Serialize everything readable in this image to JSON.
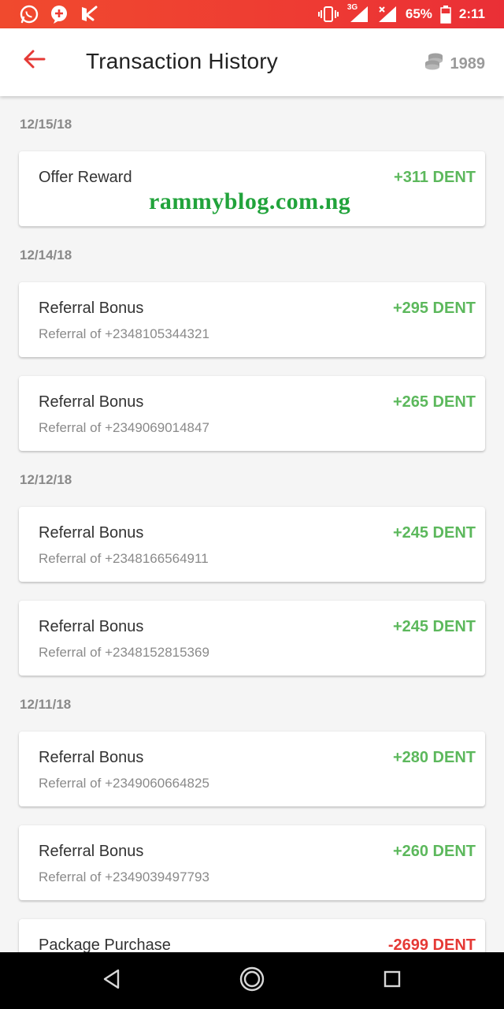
{
  "status_bar": {
    "signal_label": "3G",
    "battery": "65%",
    "time": "2:11"
  },
  "app_bar": {
    "title": "Transaction History",
    "balance": "1989"
  },
  "watermark": "rammyblog.com.ng",
  "groups": [
    {
      "date": "12/15/18",
      "transactions": [
        {
          "title": "Offer Reward",
          "subtitle": "",
          "amount": "+311 DENT"
        }
      ]
    },
    {
      "date": "12/14/18",
      "transactions": [
        {
          "title": "Referral Bonus",
          "subtitle": "Referral of +2348105344321",
          "amount": "+295 DENT"
        },
        {
          "title": "Referral Bonus",
          "subtitle": "Referral of +2349069014847",
          "amount": "+265 DENT"
        }
      ]
    },
    {
      "date": "12/12/18",
      "transactions": [
        {
          "title": "Referral Bonus",
          "subtitle": "Referral of +2348166564911",
          "amount": "+245 DENT"
        },
        {
          "title": "Referral Bonus",
          "subtitle": "Referral of +2348152815369",
          "amount": "+245 DENT"
        }
      ]
    },
    {
      "date": "12/11/18",
      "transactions": [
        {
          "title": "Referral Bonus",
          "subtitle": "Referral of +2349060664825",
          "amount": "+280 DENT"
        },
        {
          "title": "Referral Bonus",
          "subtitle": "Referral of +2349039497793",
          "amount": "+260 DENT"
        },
        {
          "title": "Package Purchase",
          "subtitle": "",
          "amount": "-2699 DENT"
        }
      ]
    }
  ],
  "colors": {
    "accent": "#e53935",
    "positive": "#5cb85c",
    "negative": "#e53935",
    "status_bar": "#ee3b33"
  },
  "icons": {
    "status_left": [
      "whatsapp-icon",
      "message-plus-icon",
      "app-notification-icon"
    ],
    "status_right": [
      "vibrate-icon",
      "signal-3g-icon",
      "signal-icon",
      "battery-icon"
    ],
    "back": "arrow-left-icon",
    "balance": "coins-icon",
    "nav": [
      "nav-back-icon",
      "nav-home-icon",
      "nav-recents-icon"
    ]
  }
}
